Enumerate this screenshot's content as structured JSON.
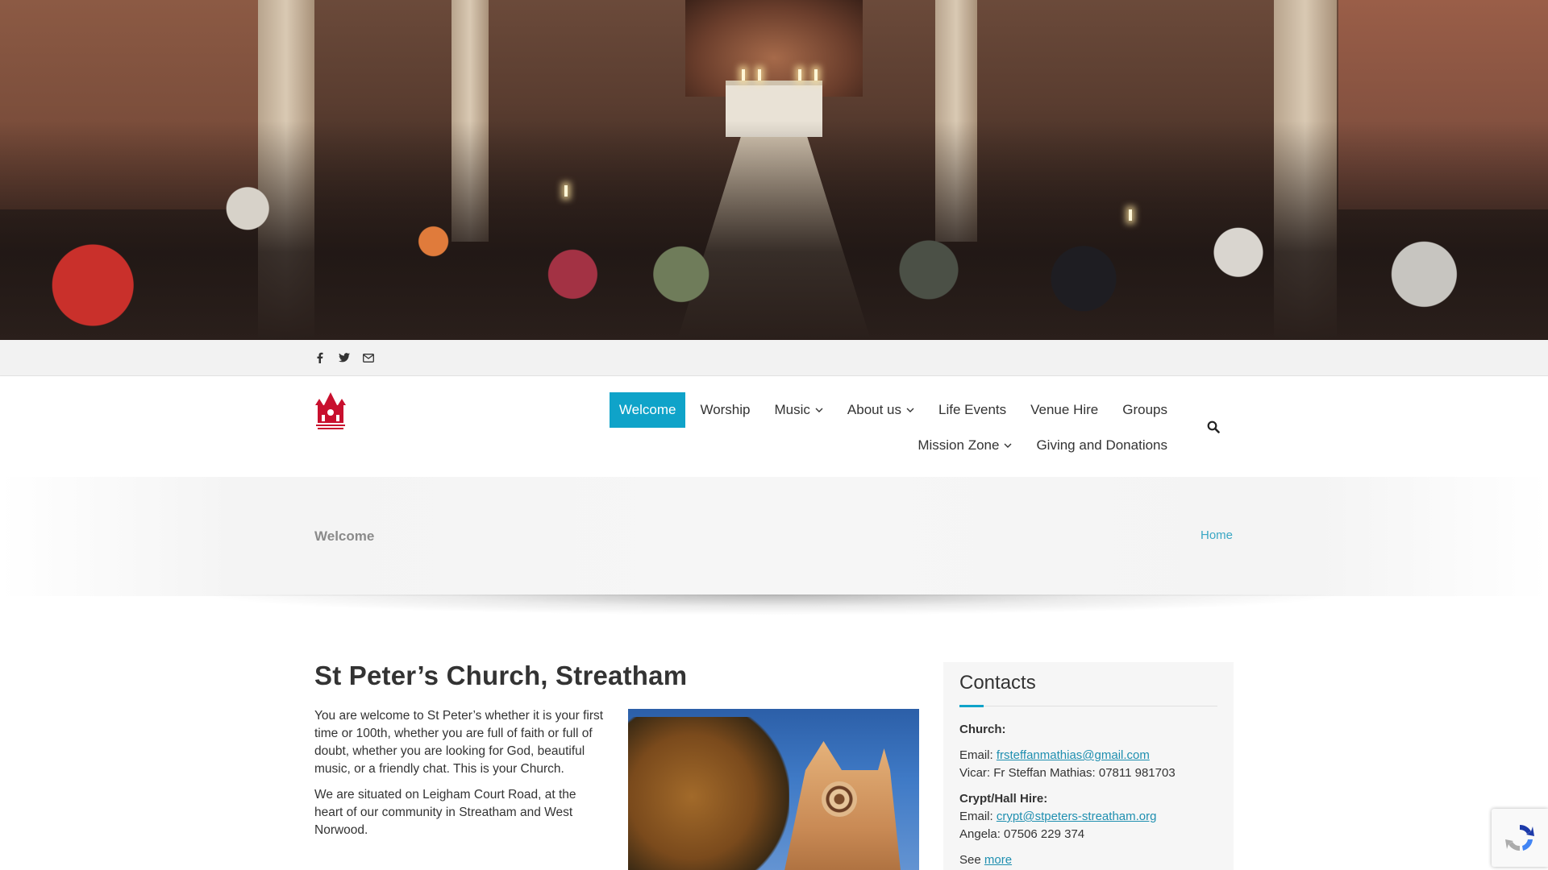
{
  "social": {
    "icons": [
      "facebook-icon",
      "twitter-icon",
      "envelope-icon"
    ]
  },
  "nav": {
    "row1": [
      {
        "label": "Welcome",
        "active": true,
        "dropdown": false
      },
      {
        "label": "Worship",
        "active": false,
        "dropdown": false
      },
      {
        "label": "Music",
        "active": false,
        "dropdown": true
      },
      {
        "label": "About us",
        "active": false,
        "dropdown": true
      },
      {
        "label": "Life Events",
        "active": false,
        "dropdown": false
      },
      {
        "label": "Venue Hire",
        "active": false,
        "dropdown": false
      },
      {
        "label": "Groups",
        "active": false,
        "dropdown": false
      }
    ],
    "row2": [
      {
        "label": "Mission Zone",
        "active": false,
        "dropdown": true
      },
      {
        "label": "Giving and Donations",
        "active": false,
        "dropdown": false
      }
    ],
    "accent_color": "#0fa3c9"
  },
  "breadcrumb": {
    "current": "Welcome",
    "home": "Home"
  },
  "main": {
    "title": "St Peter’s Church, Streatham",
    "paragraphs": [
      "You are welcome to St Peter’s whether it is your first time or 100th, whether you are full of faith or full of doubt, whether you are looking for God, beautiful music, or a friendly chat. This is your Church.",
      "We are situated on Leigham Court Road, at the heart of our community in Streatham and West Norwood."
    ]
  },
  "sidebar": {
    "title": "Contacts",
    "church_heading": "Church:",
    "church_email_label": "Email: ",
    "church_email": "frsteffanmathias@gmail.com",
    "vicar_line": "Vicar: Fr Steffan Mathias: 07811 981703",
    "crypt_heading": "Crypt/Hall Hire:",
    "crypt_email_label": "Email: ",
    "crypt_email": "crypt@stpeters-streatham.org",
    "angela_line": "Angela: 07506 229 374",
    "see_label": "See ",
    "see_link": "more"
  }
}
